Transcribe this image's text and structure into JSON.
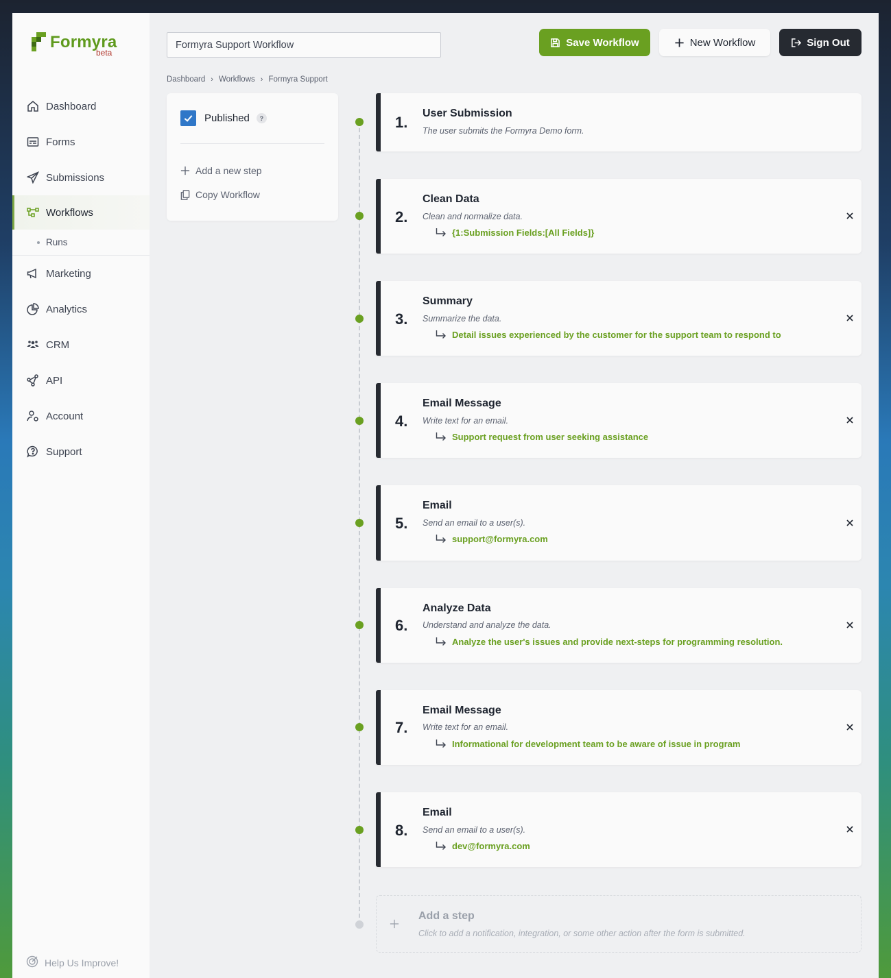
{
  "app": {
    "brand": "Formyra",
    "brand_tag": "beta",
    "colors": {
      "accent": "#6aa021",
      "dark": "#262a31",
      "check": "#2f77c8"
    }
  },
  "header": {
    "workflow_name": "Formyra Support Workflow",
    "save_label": "Save Workflow",
    "new_label": "New Workflow",
    "signout_label": "Sign Out"
  },
  "breadcrumb": [
    "Dashboard",
    "Workflows",
    "Formyra Support"
  ],
  "sidebar": {
    "items": [
      {
        "label": "Dashboard",
        "icon": "home-icon"
      },
      {
        "label": "Forms",
        "icon": "form-icon"
      },
      {
        "label": "Submissions",
        "icon": "paper-plane-icon"
      },
      {
        "label": "Workflows",
        "icon": "workflow-icon",
        "active": true
      },
      {
        "label": "Marketing",
        "icon": "megaphone-icon"
      },
      {
        "label": "Analytics",
        "icon": "pie-chart-icon"
      },
      {
        "label": "CRM",
        "icon": "users-icon"
      },
      {
        "label": "API",
        "icon": "network-icon"
      },
      {
        "label": "Account",
        "icon": "user-gear-icon"
      },
      {
        "label": "Support",
        "icon": "question-bubble-icon"
      }
    ],
    "sub_item": "Runs",
    "help_label": "Help Us Improve!"
  },
  "panel": {
    "published_label": "Published",
    "published": true,
    "help_badge": "?",
    "add_step_label": "Add a new step",
    "copy_label": "Copy Workflow"
  },
  "steps": [
    {
      "num": "1.",
      "title": "User Submission",
      "desc": "The user submits the Formyra Demo form.",
      "ref": ""
    },
    {
      "num": "2.",
      "title": "Clean Data",
      "desc": "Clean and normalize data.",
      "ref": "{1:Submission Fields:[All Fields]}"
    },
    {
      "num": "3.",
      "title": "Summary",
      "desc": "Summarize the data.",
      "ref": "Detail issues experienced by the customer for the support team to respond to"
    },
    {
      "num": "4.",
      "title": "Email Message",
      "desc": "Write text for an email.",
      "ref": "Support request from user seeking assistance"
    },
    {
      "num": "5.",
      "title": "Email",
      "desc": "Send an email to a user(s).",
      "ref": "support@formyra.com"
    },
    {
      "num": "6.",
      "title": "Analyze Data",
      "desc": "Understand and analyze the data.",
      "ref": "Analyze the user's issues and provide next-steps for programming resolution."
    },
    {
      "num": "7.",
      "title": "Email Message",
      "desc": "Write text for an email.",
      "ref": "Informational for development team to be aware of issue in program"
    },
    {
      "num": "8.",
      "title": "Email",
      "desc": "Send an email to a user(s).",
      "ref": "dev@formyra.com"
    }
  ],
  "add_step": {
    "title": "Add a step",
    "desc": "Click to add a notification, integration, or some other action after the form is submitted."
  }
}
